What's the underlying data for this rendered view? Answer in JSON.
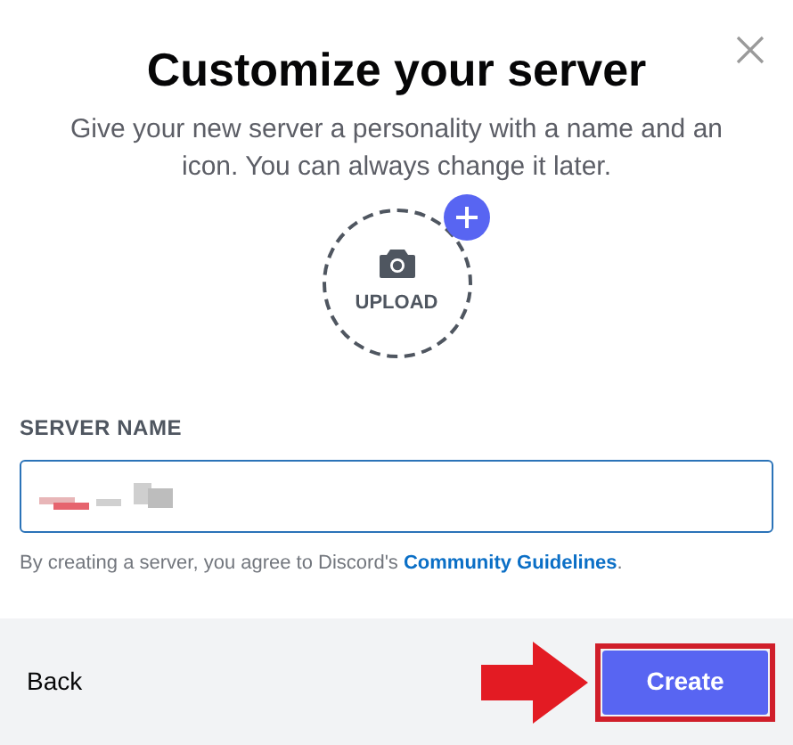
{
  "dialog": {
    "title": "Customize your server",
    "subtitle": "Give your new server a personality with a name and an icon. You can always change it later."
  },
  "upload": {
    "label": "UPLOAD"
  },
  "server_name": {
    "label": "SERVER NAME"
  },
  "agreement": {
    "text": "By creating a server, you agree to Discord's",
    "link": "Community Guidelines",
    "end": "."
  },
  "footer": {
    "back": "Back",
    "create": "Create",
    "highlighted": true
  }
}
